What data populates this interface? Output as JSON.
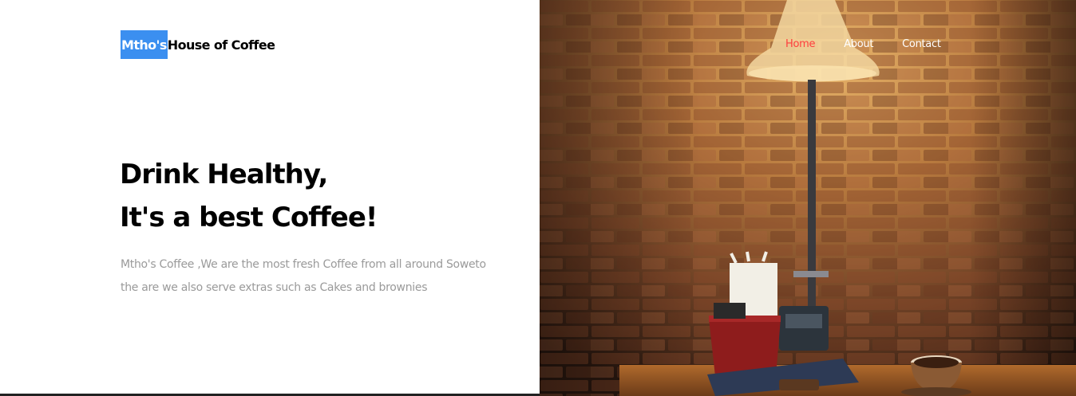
{
  "brand": {
    "highlight": "Mtho's",
    "rest": "House of Coffee"
  },
  "nav": {
    "items": [
      {
        "label": "Home",
        "active": true
      },
      {
        "label": "About",
        "active": false
      },
      {
        "label": "Contact",
        "active": false
      }
    ]
  },
  "hero": {
    "headline_line1": "Drink Healthy,",
    "headline_line2": "It's a best Coffee!",
    "description_line1": "Mtho's Coffee ,We are the most fresh Coffee from all around Soweto",
    "description_line2": "the are we also serve extras such as Cakes and brownies",
    "image_subject": "brick wall with lamp, table with coffee cup and cutlery holder"
  },
  "colors": {
    "brand_highlight": "#3b8ff0",
    "nav_active": "#ff3d3d",
    "nav_text": "#ffffff",
    "headline": "#000000",
    "description": "#9a9a9a"
  }
}
